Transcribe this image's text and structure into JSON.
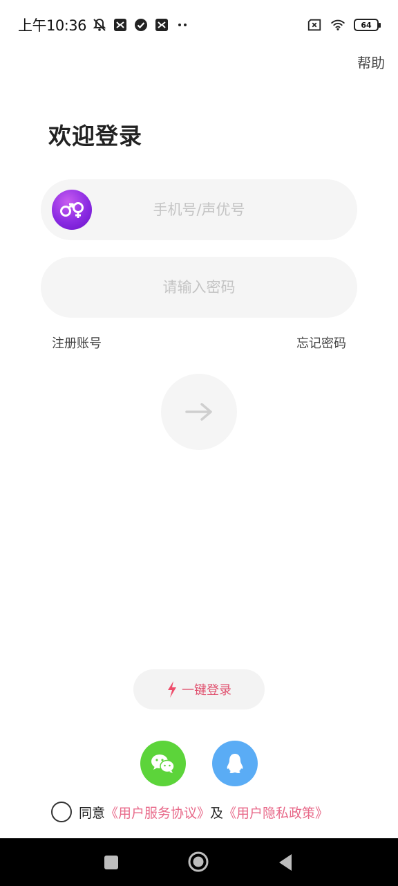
{
  "status_bar": {
    "time": "上午10:36",
    "battery": "64",
    "icons": [
      "mute-icon",
      "app-notification-icon",
      "check-circle-icon",
      "app-notification-icon",
      "more-dots-icon",
      "sim-x-icon",
      "wifi-icon",
      "battery-icon"
    ]
  },
  "header": {
    "help_label": "帮助"
  },
  "title": "欢迎登录",
  "phone_field": {
    "placeholder": "手机号/声优号",
    "value": "",
    "avatar_icon": "gender-symbols-icon"
  },
  "password_field": {
    "placeholder": "请输入密码",
    "value": ""
  },
  "links": {
    "register": "注册账号",
    "forgot": "忘记密码"
  },
  "submit": {
    "icon": "arrow-right-icon"
  },
  "one_key_login": {
    "label": "一键登录",
    "icon": "lightning-icon"
  },
  "social": [
    {
      "name": "wechat",
      "icon": "wechat-icon",
      "color": "#5cd43a"
    },
    {
      "name": "qq",
      "icon": "qq-icon",
      "color": "#5aacf5"
    }
  ],
  "agreement": {
    "prefix": "同意",
    "service": "《用户服务协议》",
    "and": "及",
    "privacy": "《用户隐私政策》"
  },
  "colors": {
    "accent": "#e0506e",
    "link": "#e86a8a",
    "field_bg": "#f5f5f5"
  }
}
